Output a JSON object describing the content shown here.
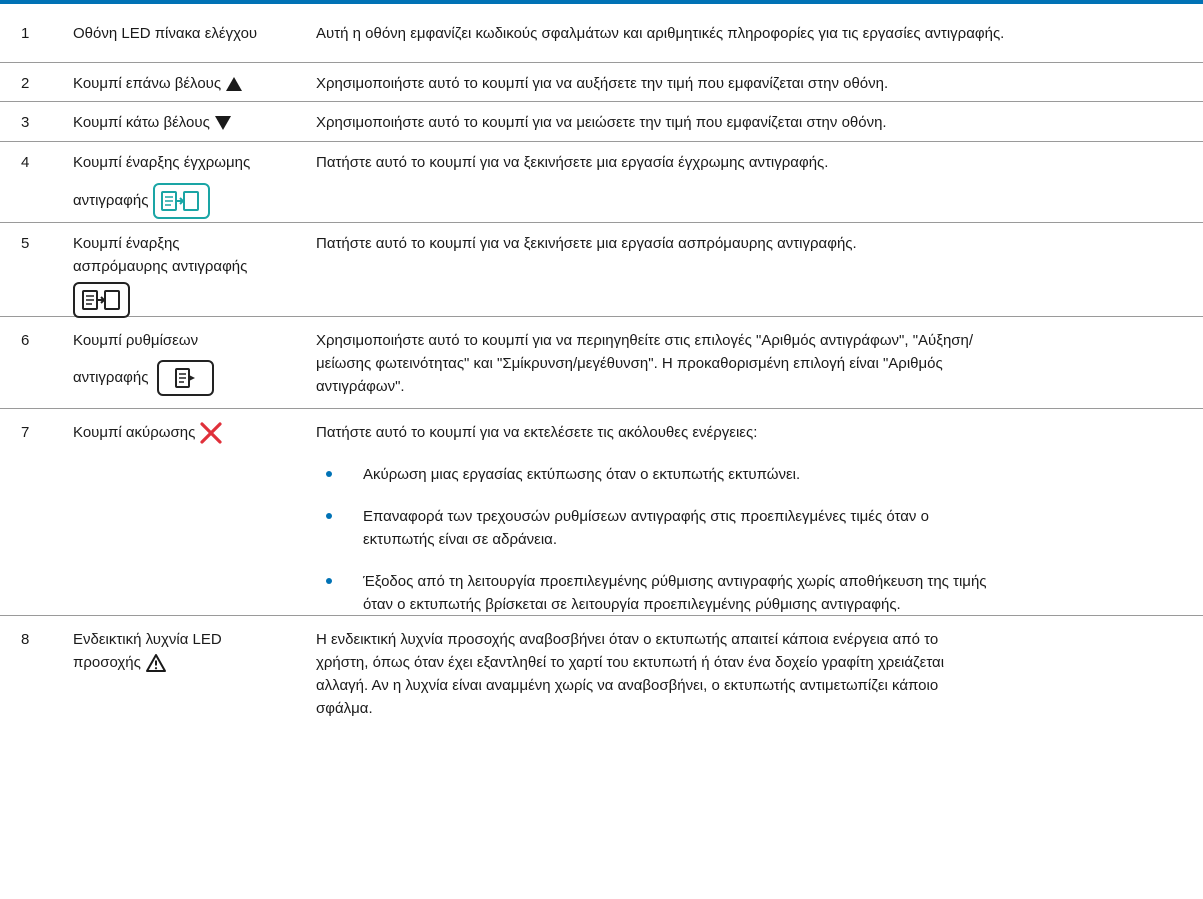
{
  "colors": {
    "accent": "#0072b5",
    "text": "#1a1a1a",
    "rule": "#9a9a9a",
    "cancel": "#e0303a",
    "color_copy": "#1aa5a5"
  },
  "rows": [
    {
      "num": "1",
      "name": "Οθόνη LED πίνακα ελέγχου",
      "desc": "Αυτή η οθόνη εμφανίζει κωδικούς σφαλμάτων και αριθμητικές πληροφορίες για τις εργασίες αντιγραφής."
    },
    {
      "num": "2",
      "name": "Κουμπί επάνω βέλους",
      "icon": "up-arrow-icon",
      "desc": "Χρησιμοποιήστε αυτό το κουμπί για να αυξήσετε την τιμή που εμφανίζεται στην οθόνη."
    },
    {
      "num": "3",
      "name": "Κουμπί κάτω βέλους",
      "icon": "down-arrow-icon",
      "desc": "Χρησιμοποιήστε αυτό το κουμπί για να μειώσετε την τιμή που εμφανίζεται στην οθόνη."
    },
    {
      "num": "4",
      "name_line1": "Κουμπί έναρξης έγχρωμης",
      "name_line2": "αντιγραφής",
      "icon": "color-copy-icon",
      "desc": "Πατήστε αυτό το κουμπί για να ξεκινήσετε μια εργασία έγχρωμης αντιγραφής."
    },
    {
      "num": "5",
      "name_line1": "Κουμπί έναρξης",
      "name_line2": "ασπρόμαυρης αντιγραφής",
      "icon": "mono-copy-icon",
      "desc": "Πατήστε αυτό το κουμπί για να ξεκινήσετε μια εργασία ασπρόμαυρης αντιγραφής."
    },
    {
      "num": "6",
      "name_line1": "Κουμπί ρυθμίσεων",
      "name_line2": "αντιγραφής",
      "icon": "copy-settings-icon",
      "desc_lines": [
        "Χρησιμοποιήστε αυτό το κουμπί για να περιηγηθείτε στις επιλογές \"Αριθμός αντιγράφων\", \"Αύξηση/",
        "μείωσης φωτεινότητας\" και \"Σμίκρυνση/μεγέθυνση\". Η προκαθορισμένη επιλογή είναι \"Αριθμός",
        "αντιγράφων\"."
      ]
    },
    {
      "num": "7",
      "name": "Κουμπί ακύρωσης",
      "icon": "cancel-x-icon",
      "desc": "Πατήστε αυτό το κουμπί για να εκτελέσετε τις ακόλουθες ενέργειες:",
      "bullets": [
        [
          "Ακύρωση μιας εργασίας εκτύπωσης όταν ο εκτυπωτής εκτυπώνει."
        ],
        [
          "Επαναφορά των τρεχουσών ρυθμίσεων αντιγραφής στις προεπιλεγμένες τιμές όταν ο",
          "εκτυπωτής είναι σε αδράνεια."
        ],
        [
          "Έξοδος από τη λειτουργία προεπιλεγμένης ρύθμισης αντιγραφής χωρίς αποθήκευση της τιμής",
          "όταν ο εκτυπωτής βρίσκεται σε λειτουργία προεπιλεγμένης ρύθμισης αντιγραφής."
        ]
      ]
    },
    {
      "num": "8",
      "name_line1": "Ενδεικτική λυχνία LED",
      "name_line2": "προσοχής",
      "icon": "warning-triangle-icon",
      "desc_lines": [
        "Η ενδεικτική λυχνία προσοχής αναβοσβήνει όταν ο εκτυπωτής απαιτεί κάποια ενέργεια από το",
        "χρήστη, όπως όταν έχει εξαντληθεί το χαρτί του εκτυπωτή ή όταν ένα δοχείο γραφίτη χρειάζεται",
        "αλλαγή. Αν η λυχνία είναι αναμμένη χωρίς να αναβοσβήνει, ο εκτυπωτής αντιμετωπίζει κάποιο",
        "σφάλμα."
      ]
    }
  ]
}
